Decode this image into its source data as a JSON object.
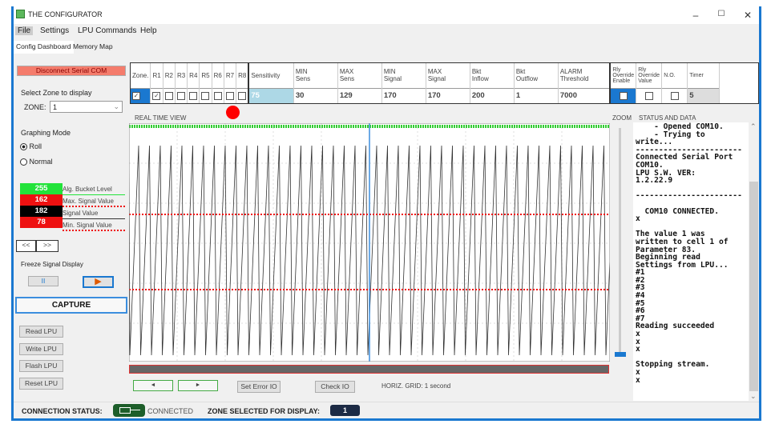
{
  "window": {
    "title": "THE CONFIGURATOR",
    "min": "–",
    "max": "☐",
    "close": "✕"
  },
  "menu": [
    "File",
    "Settings",
    "LPU Commands",
    "Help"
  ],
  "tabs": [
    "Config Dashboard",
    "Memory Map"
  ],
  "left": {
    "disconnect": "Disconnect Serial COM",
    "zone_group": "Select Zone to display",
    "zone_label": "ZONE:",
    "zone_value": "1",
    "graph_group": "Graphing Mode",
    "mode_roll": "Roll",
    "mode_normal": "Normal",
    "mode_selected": "Roll",
    "legend": [
      {
        "value": "255",
        "label": "Alg. Bucket Level",
        "color": "#22e33a"
      },
      {
        "value": "162",
        "label": "Max. Signal Value",
        "color": "#ee1111"
      },
      {
        "value": "182",
        "label": "Signal Value",
        "color": "#000000"
      },
      {
        "value": "78",
        "label": "Min. Signal Value",
        "color": "#ee1111"
      }
    ],
    "prev": "<<",
    "next": ">>",
    "freeze_group": "Freeze Signal Display",
    "pause": "II",
    "play": "▶",
    "capture": "CAPTURE",
    "lpu_buttons": [
      "Read LPU",
      "Write LPU",
      "Flash LPU",
      "Reset LPU"
    ]
  },
  "table": {
    "zone_headers": [
      "Zone.",
      "R1",
      "R2",
      "R3",
      "R4",
      "R5",
      "R6",
      "R7",
      "R8"
    ],
    "zone_checked": [
      true,
      true,
      false,
      false,
      false,
      false,
      false,
      false,
      false
    ],
    "param_headers": [
      "Sensitivity",
      "MIN\nSens",
      "MAX\nSens",
      "MIN\nSignal",
      "MAX\nSignal",
      "Bkt\nInflow",
      "Bkt\nOutflow",
      "ALARM\nThreshold"
    ],
    "param_values": [
      "75",
      "30",
      "129",
      "170",
      "170",
      "200",
      "1",
      "7000"
    ],
    "relay_headers": [
      "Rly\nOverride\nEnable",
      "Rly\nOverride\nValue",
      "N.O.",
      "Timer"
    ],
    "relay_checked": [
      false,
      false,
      false
    ],
    "timer": "5"
  },
  "graph": {
    "title": "REAL TIME VIEW",
    "zoom_label": "ZOOM",
    "status_title": "STATUS AND DATA",
    "horiz_grid": "HORIZ. GRID: 1 second",
    "scroll_left": "◄",
    "scroll_right": "►",
    "set_error": "Set Error IO",
    "check_io": "Check IO"
  },
  "status_log": "    - Opened COM10.\n    - Trying to\nwrite...\n-----------------------\nConnected Serial Port\nCOM10.\nLPU S.W. VER:\n1.2.22.9\n\n-----------------------\n\n  COM10 CONNECTED.\nx\n\nThe value 1 was\nwritten to cell 1 of\nParameter 83.\nBeginning read\nSettings from LPU...\n#1\n#2\n#3\n#4\n#5\n#6\n#7\nReading succeeded\nx\nx\nx\n\nStopping stream.\nx\nx",
  "footer": {
    "conn_label": "CONNECTION STATUS:",
    "conn_value": "CONNECTED",
    "zone_label": "ZONE SELECTED FOR DISPLAY:",
    "zone_value": "1"
  }
}
